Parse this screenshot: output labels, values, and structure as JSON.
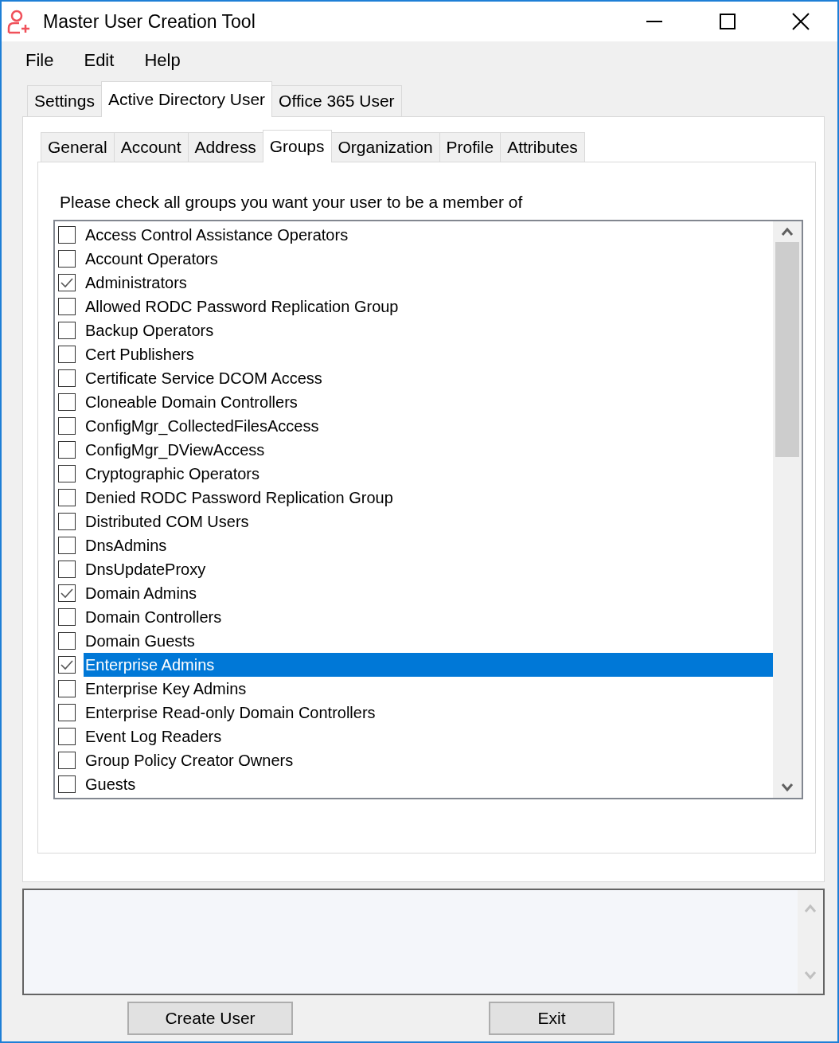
{
  "window": {
    "title": "Master User Creation Tool"
  },
  "menu": [
    "File",
    "Edit",
    "Help"
  ],
  "tabs": [
    {
      "label": "Settings",
      "selected": false
    },
    {
      "label": "Active Directory User",
      "selected": true
    },
    {
      "label": "Office 365 User",
      "selected": false
    }
  ],
  "subtabs": [
    {
      "label": "General",
      "selected": false
    },
    {
      "label": "Account",
      "selected": false
    },
    {
      "label": "Address",
      "selected": false
    },
    {
      "label": "Groups",
      "selected": true
    },
    {
      "label": "Organization",
      "selected": false
    },
    {
      "label": "Profile",
      "selected": false
    },
    {
      "label": "Attributes",
      "selected": false
    }
  ],
  "groups_prompt": "Please check all groups you want your user to be a member of",
  "groups": [
    {
      "name": "Access Control Assistance Operators",
      "checked": false,
      "selected": false
    },
    {
      "name": "Account Operators",
      "checked": false,
      "selected": false
    },
    {
      "name": "Administrators",
      "checked": true,
      "selected": false
    },
    {
      "name": "Allowed RODC Password Replication Group",
      "checked": false,
      "selected": false
    },
    {
      "name": "Backup Operators",
      "checked": false,
      "selected": false
    },
    {
      "name": "Cert Publishers",
      "checked": false,
      "selected": false
    },
    {
      "name": "Certificate Service DCOM Access",
      "checked": false,
      "selected": false
    },
    {
      "name": "Cloneable Domain Controllers",
      "checked": false,
      "selected": false
    },
    {
      "name": "ConfigMgr_CollectedFilesAccess",
      "checked": false,
      "selected": false
    },
    {
      "name": "ConfigMgr_DViewAccess",
      "checked": false,
      "selected": false
    },
    {
      "name": "Cryptographic Operators",
      "checked": false,
      "selected": false
    },
    {
      "name": "Denied RODC Password Replication Group",
      "checked": false,
      "selected": false
    },
    {
      "name": "Distributed COM Users",
      "checked": false,
      "selected": false
    },
    {
      "name": "DnsAdmins",
      "checked": false,
      "selected": false
    },
    {
      "name": "DnsUpdateProxy",
      "checked": false,
      "selected": false
    },
    {
      "name": "Domain Admins",
      "checked": true,
      "selected": false
    },
    {
      "name": "Domain Controllers",
      "checked": false,
      "selected": false
    },
    {
      "name": "Domain Guests",
      "checked": false,
      "selected": false
    },
    {
      "name": "Enterprise Admins",
      "checked": true,
      "selected": true
    },
    {
      "name": "Enterprise Key Admins",
      "checked": false,
      "selected": false
    },
    {
      "name": "Enterprise Read-only Domain Controllers",
      "checked": false,
      "selected": false
    },
    {
      "name": "Event Log Readers",
      "checked": false,
      "selected": false
    },
    {
      "name": "Group Policy Creator Owners",
      "checked": false,
      "selected": false
    },
    {
      "name": "Guests",
      "checked": false,
      "selected": false
    }
  ],
  "buttons": [
    "Create User",
    "Exit"
  ]
}
